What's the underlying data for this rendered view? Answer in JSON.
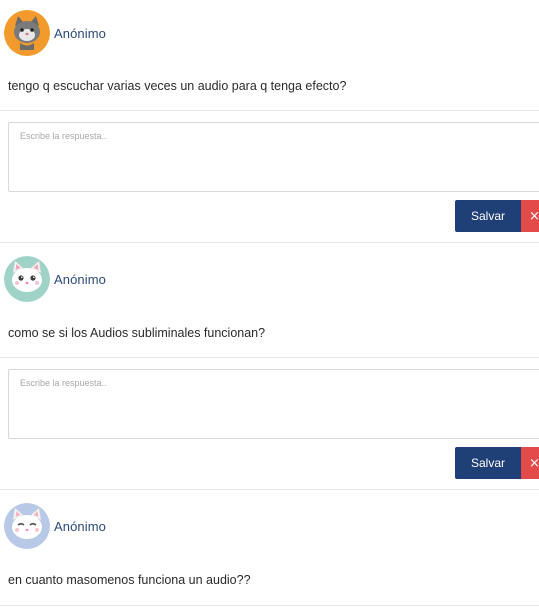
{
  "comments": [
    {
      "author": "Anónimo",
      "avatar_icon": "cat-avatar-orange-icon",
      "text": "tengo q escuchar varias veces un audio para q tenga efecto?",
      "reply_placeholder": "Escribe la respuesta..",
      "save_label": "Salvar",
      "close_glyph": "×"
    },
    {
      "author": "Anónimo",
      "avatar_icon": "cat-avatar-teal-icon",
      "text": "como se si los Audios subliminales funcionan?",
      "reply_placeholder": "Escribe la respuesta..",
      "save_label": "Salvar",
      "close_glyph": "×"
    },
    {
      "author": "Anónimo",
      "avatar_icon": "cat-avatar-blue-icon",
      "text": "en cuanto masomenos funciona un audio??"
    }
  ],
  "colors": {
    "author_name": "#2b4a7a",
    "save_button": "#1f3f77",
    "close_button": "#e34b4b",
    "divider": "#e6e6e6"
  }
}
